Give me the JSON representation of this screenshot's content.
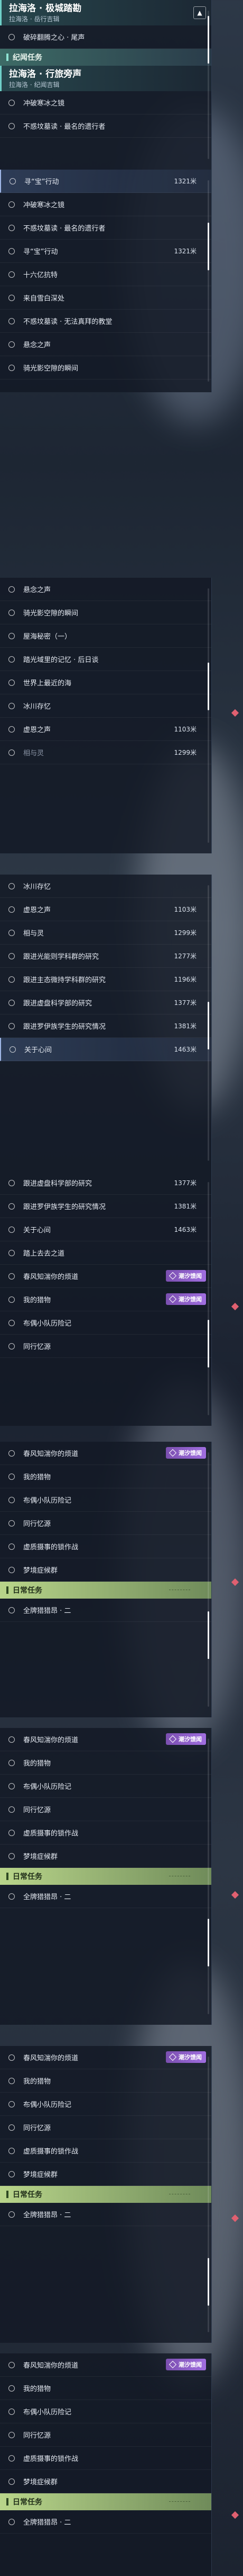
{
  "header": {
    "title": "拉海洛 · 极城踏勘",
    "subtitle": "拉海洛 · 岳行吉辑",
    "collapse_icon": "chevron-up-icon"
  },
  "sub_header_1": {
    "label": "纪闻任务"
  },
  "header2": {
    "title": "拉海洛 · 行旅旁声",
    "subtitle": "拉海洛 · 纪闻吉辑"
  },
  "top_items": [
    {
      "label": "破碎翻腾之心 · 尾声"
    }
  ],
  "group1": [
    {
      "label": "冲破寒冰之镜",
      "dist": ""
    },
    {
      "label": "不惑坟墓读 · 最名的遗行者",
      "dist": ""
    },
    {
      "label": "寻“宝”行动",
      "dist": "1321米"
    },
    {
      "label": "冲破寒冰之镜",
      "dist": ""
    },
    {
      "label": "不惑坟墓读 · 最名的遗行者",
      "dist": ""
    },
    {
      "label": "寻“宝”行动",
      "dist": "1321米"
    },
    {
      "label": "十六亿抗特",
      "dist": ""
    },
    {
      "label": "来自雪白深处",
      "dist": ""
    },
    {
      "label": "不惑坟墓读 · 无法真拜的教堂",
      "dist": ""
    },
    {
      "label": "悬念之声",
      "dist": ""
    },
    {
      "label": "骑光影空隙的瞬间",
      "dist": ""
    },
    {
      "label": "悬念之声",
      "dist": ""
    },
    {
      "label": "骑光影空隙的瞬间",
      "dist": ""
    },
    {
      "label": "屋海秘密（一）",
      "dist": ""
    },
    {
      "label": "踏光域里的记忆 · 后日谈",
      "dist": ""
    },
    {
      "label": "世界上最近的海",
      "dist": ""
    },
    {
      "label": "冰川存忆",
      "dist": ""
    },
    {
      "label": "虚恩之声",
      "dist": "1103米"
    },
    {
      "label": "相与灵",
      "dist": "1299米"
    },
    {
      "label": "冰川存忆",
      "dist": ""
    },
    {
      "label": "虚恩之声",
      "dist": "1103米"
    },
    {
      "label": "相与灵",
      "dist": "1299米"
    },
    {
      "label": "跟进光能则学科群的研究",
      "dist": "1277米"
    },
    {
      "label": "跟进主态微持学科群的研究",
      "dist": "1196米"
    },
    {
      "label": "跟进虚盘科学部的研究",
      "dist": "1377米"
    },
    {
      "label": "跟进罗伊族学生的研究情况",
      "dist": "1381米"
    },
    {
      "label": "关于心间",
      "dist": "1463米"
    },
    {
      "label": "跟进虚盘科学部的研究",
      "dist": "1377米"
    },
    {
      "label": "跟进罗伊族学生的研究情况",
      "dist": "1381米"
    },
    {
      "label": "关于心间",
      "dist": "1463米"
    },
    {
      "label": "踏上去去之道",
      "dist": ""
    }
  ],
  "badge": {
    "label": "潮汐馈闻",
    "icon": "tide-diamond-icon"
  },
  "repeat_items": [
    "春风知湍你的烦道",
    "我的猎物",
    "布偶小队历险记",
    "同行忆源",
    "虚质摄事的锁作战",
    "梦境症候群"
  ],
  "daily": {
    "label": "日常任务",
    "item": "全牌猎猎昂 · 二"
  }
}
